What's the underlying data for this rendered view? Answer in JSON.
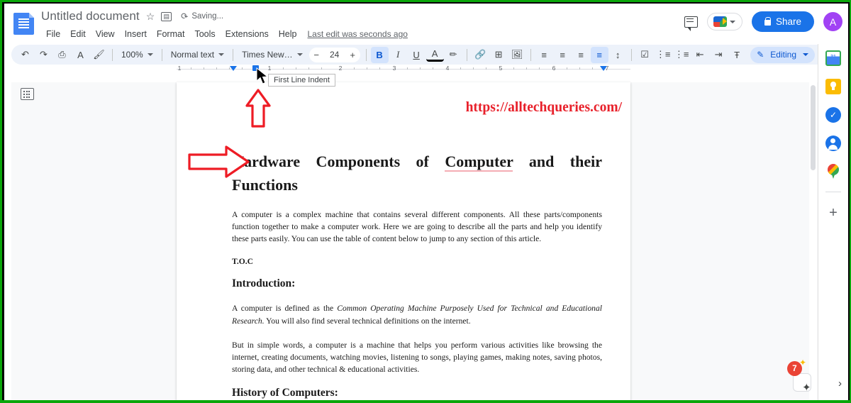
{
  "header": {
    "doc_title": "Untitled document",
    "star_icon": "star-icon",
    "move_icon": "move-to-folder-icon",
    "sync_icon": "sync-icon",
    "saving_status": "Saving...",
    "menu": [
      "File",
      "Edit",
      "View",
      "Insert",
      "Format",
      "Tools",
      "Extensions",
      "Help"
    ],
    "last_edit": "Last edit was seconds ago",
    "comment_icon": "comment-icon",
    "meet_icon": "google-meet-icon",
    "share_label": "Share",
    "lock_icon": "lock-icon",
    "avatar_initial": "A",
    "avatar_color": "#a142f4",
    "share_color": "#1a73e8"
  },
  "toolbar": {
    "undo": "↶",
    "redo": "↷",
    "print": "⎙",
    "spellcheck": "A",
    "paint_format": "🖌",
    "zoom_value": "100%",
    "style_value": "Normal text",
    "font_value": "Times New…",
    "font_size": "24",
    "minus": "−",
    "plus": "+",
    "bold": "B",
    "italic": "I",
    "underline": "U",
    "text_color": "A",
    "highlight": "✏",
    "link": "🔗",
    "comment_add": "⊞",
    "image": "🖼",
    "align_left": "≡",
    "align_center": "≡",
    "align_right": "≡",
    "align_justify": "≡",
    "line_spacing": "↕",
    "checklist": "☑",
    "bulleted_list": "⋮≡",
    "numbered_list": "⋮≡",
    "decrease_indent": "⇤",
    "increase_indent": "⇥",
    "clear_formatting": "Ŧ",
    "mode_label": "Editing",
    "mode_icon": "pencil-icon",
    "collapse_icon": "chevron-up-icon"
  },
  "ruler": {
    "numbers": [
      "1",
      "1",
      "2",
      "3",
      "4",
      "5",
      "6",
      "7"
    ],
    "tooltip": "First Line Indent"
  },
  "document": {
    "watermark": "https://alltechqueries.com/",
    "title_part1": "Hardware  Components  of  ",
    "title_spell": "Computer",
    "title_part2": "  and their Functions",
    "paragraph1": "A computer is a complex machine that contains several different components. All these parts/components function together to make a computer work. Here we are going to describe all the parts and help you identify these parts easily. You can use the table of content below to jump to any section of this article.",
    "toc_label": "T.O.C",
    "heading_intro": "Introduction:",
    "intro_p_start": "A computer is defined as the ",
    "intro_p_italic": "Common Operating Machine Purposely Used for Technical and Educational Research.",
    "intro_p_end": " You will also find several technical definitions on the internet.",
    "paragraph3": "But in simple words, a computer is a machine that helps you perform various activities like browsing the internet, creating documents, watching movies, listening to songs, playing games, making notes, saving photos, storing data, and other technical & educational activities.",
    "heading_history": "History of Computers:",
    "annotation_color": "#e8202a"
  },
  "left_panel": {
    "outline_icon": "document-outline-icon"
  },
  "right_rail": {
    "items": [
      {
        "name": "google-calendar-icon",
        "label": "31"
      },
      {
        "name": "google-keep-icon",
        "label": ""
      },
      {
        "name": "google-tasks-icon",
        "label": "✓"
      },
      {
        "name": "google-contacts-icon",
        "label": ""
      },
      {
        "name": "google-maps-icon",
        "label": ""
      }
    ],
    "add_on_label": "+"
  },
  "bottom": {
    "notification_count": "7",
    "gemini_icon": "gemini-sparkle-icon",
    "expand_icon": "chevron-right-icon"
  }
}
